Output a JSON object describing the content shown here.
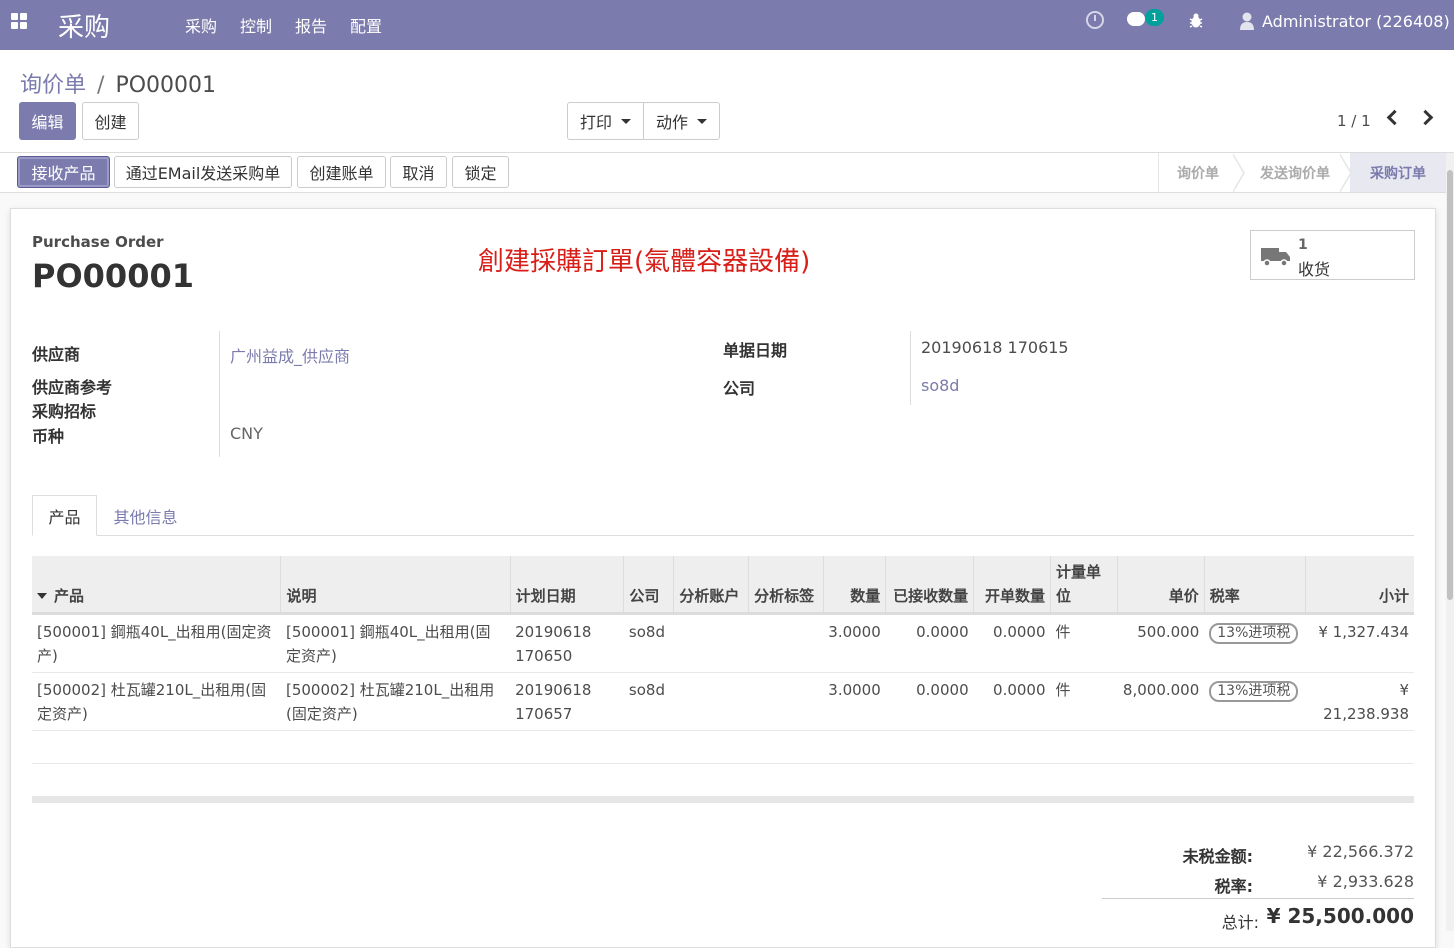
{
  "nav": {
    "app_title": "采购",
    "menu": [
      "采购",
      "控制",
      "报告",
      "配置"
    ],
    "chat_badge": "1",
    "user": "Administrator (226408)"
  },
  "control": {
    "breadcrumb_parent": "询价单",
    "breadcrumb_sep": "/",
    "breadcrumb_current": "PO00001",
    "edit_label": "编辑",
    "create_label": "创建",
    "print_label": "打印",
    "action_label": "动作",
    "pager": "1 / 1"
  },
  "status_buttons": [
    "接收产品",
    "通过EMail发送采购单",
    "创建账单",
    "取消",
    "锁定"
  ],
  "stages": [
    "询价单",
    "发送询价单",
    "采购订单"
  ],
  "form": {
    "doc_label": "Purchase Order",
    "doc_name": "PO00001",
    "note": "創建採購訂單(氣體容器設備)",
    "smart_value": "1",
    "smart_label": "收货",
    "vendor_label": "供应商",
    "vendor_value": "广州益成_供应商",
    "vendor_ref_label": "供应商参考",
    "tender_label": "采购招标",
    "currency_label": "币种",
    "currency_value": "CNY",
    "date_label": "单据日期",
    "date_value": "20190618 170615",
    "company_label": "公司",
    "company_value": "so8d"
  },
  "tabs": [
    "产品",
    "其他信息"
  ],
  "lines": {
    "headers": [
      "产品",
      "说明",
      "计划日期",
      "公司",
      "分析账户",
      "分析标签",
      "数量",
      "已接收数量",
      "开单数量",
      "计量单位",
      "单价",
      "税率",
      "小计"
    ],
    "rows": [
      {
        "product": "[500001] 鋼瓶40L_出租用(固定资产)",
        "desc": "[500001] 鋼瓶40L_出租用(固定资产)",
        "date": "20190618 170650",
        "company": "so8d",
        "account": "",
        "tags": "",
        "qty": "3.0000",
        "received": "0.0000",
        "billed": "0.0000",
        "uom": "件",
        "price": "500.000",
        "tax": "13%进项税",
        "subtotal": "¥ 1,327.434"
      },
      {
        "product": "[500002] 杜瓦罐210L_出租用(固定资产)",
        "desc": "[500002] 杜瓦罐210L_出租用(固定资产)",
        "date": "20190618 170657",
        "company": "so8d",
        "account": "",
        "tags": "",
        "qty": "3.0000",
        "received": "0.0000",
        "billed": "0.0000",
        "uom": "件",
        "price": "8,000.000",
        "tax": "13%进项税",
        "subtotal": "¥ 21,238.938"
      }
    ]
  },
  "totals": {
    "untaxed_label": "未税金额:",
    "untaxed_value": "¥ 22,566.372",
    "tax_label": "税率:",
    "tax_value": "¥ 2,933.628",
    "total_label": "总计:",
    "total_value": "¥ 25,500.000"
  },
  "colors": {
    "brand": "#7c7bad",
    "note": "#d91e18"
  }
}
